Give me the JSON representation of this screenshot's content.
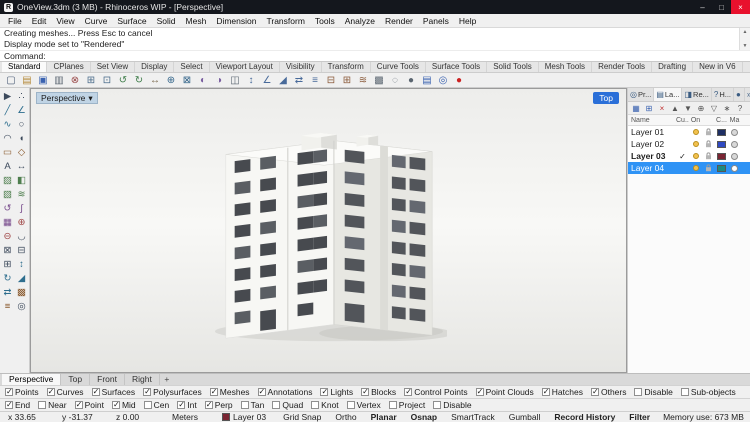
{
  "colors": {
    "selection_blue": "#2f93f5",
    "titlebar": "#14171d",
    "top_button_blue": "#2a6fd8",
    "bulb_yellow": "#f2c14e"
  },
  "window": {
    "title": "OneView.3dm (3 MB) - Rhinoceros WIP - [Perspective]",
    "app_initial": "R",
    "minimize": "–",
    "maximize": "□",
    "close": "×"
  },
  "menu": {
    "items": [
      "File",
      "Edit",
      "View",
      "Curve",
      "Surface",
      "Solid",
      "Mesh",
      "Dimension",
      "Transform",
      "Tools",
      "Analyze",
      "Render",
      "Panels",
      "Help"
    ]
  },
  "command": {
    "history_line1": "Creating meshes... Press Esc to cancel",
    "history_line2": "Display mode set to \"Rendered\"",
    "prompt": "Command:",
    "scroll_up": "▲",
    "scroll_down": "▼"
  },
  "toolbar_tabs": {
    "items": [
      {
        "label": "Standard",
        "active": true
      },
      {
        "label": "CPlanes",
        "active": false
      },
      {
        "label": "Set View",
        "active": false
      },
      {
        "label": "Display",
        "active": false
      },
      {
        "label": "Select",
        "active": false
      },
      {
        "label": "Viewport Layout",
        "active": false
      },
      {
        "label": "Visibility",
        "active": false
      },
      {
        "label": "Transform",
        "active": false
      },
      {
        "label": "Curve Tools",
        "active": false
      },
      {
        "label": "Surface Tools",
        "active": false
      },
      {
        "label": "Solid Tools",
        "active": false
      },
      {
        "label": "Mesh Tools",
        "active": false
      },
      {
        "label": "Render Tools",
        "active": false
      },
      {
        "label": "Drafting",
        "active": false
      },
      {
        "label": "New in V6",
        "active": false
      }
    ]
  },
  "main_toolbar": {
    "icons": [
      {
        "name": "new-file-icon",
        "glyph": "▢",
        "color": "#4a5b75"
      },
      {
        "name": "open-file-icon",
        "glyph": "▤",
        "color": "#b58a3a"
      },
      {
        "name": "save-file-icon",
        "glyph": "▣",
        "color": "#3a62b0"
      },
      {
        "name": "print-icon",
        "glyph": "▥",
        "color": "#5a6570"
      },
      {
        "name": "cut-icon",
        "glyph": "⊗",
        "color": "#9a4a4a"
      },
      {
        "name": "copy-icon",
        "glyph": "⊞",
        "color": "#4a6b8a"
      },
      {
        "name": "paste-icon",
        "glyph": "⊡",
        "color": "#4a6b8a"
      },
      {
        "name": "undo-icon",
        "glyph": "↺",
        "color": "#3f7d4a"
      },
      {
        "name": "redo-icon",
        "glyph": "↻",
        "color": "#3f7d4a"
      },
      {
        "name": "pan-view-icon",
        "glyph": "↔",
        "color": "#77664a"
      },
      {
        "name": "zoom-extents-icon",
        "glyph": "⊕",
        "color": "#33658a"
      },
      {
        "name": "zoom-window-icon",
        "glyph": "⊠",
        "color": "#33658a"
      },
      {
        "name": "rotate-view-icon",
        "glyph": "◐",
        "color": "#7a5fa0"
      },
      {
        "name": "shaded-view-icon",
        "glyph": "◑",
        "color": "#7a5fa0"
      },
      {
        "name": "wireframe-view-icon",
        "glyph": "◫",
        "color": "#5a6570"
      },
      {
        "name": "move-icon",
        "glyph": "↕",
        "color": "#486a9a"
      },
      {
        "name": "rotate-icon",
        "glyph": "∠",
        "color": "#486a9a"
      },
      {
        "name": "scale-icon",
        "glyph": "◢",
        "color": "#486a9a"
      },
      {
        "name": "mirror-icon",
        "glyph": "⇄",
        "color": "#486a9a"
      },
      {
        "name": "offset-icon",
        "glyph": "≡",
        "color": "#486a9a"
      },
      {
        "name": "trim-icon",
        "glyph": "⊟",
        "color": "#8a5a3a"
      },
      {
        "name": "split-icon",
        "glyph": "⊞",
        "color": "#8a5a3a"
      },
      {
        "name": "join-icon",
        "glyph": "≋",
        "color": "#8a5a3a"
      },
      {
        "name": "group-icon",
        "glyph": "▩",
        "color": "#5a6570"
      },
      {
        "name": "hide-object-icon",
        "glyph": "◌",
        "color": "#5a6570"
      },
      {
        "name": "lock-object-icon",
        "glyph": "●",
        "color": "#5a6570"
      },
      {
        "name": "layers-icon",
        "glyph": "▤",
        "color": "#3a62b0"
      },
      {
        "name": "properties-icon",
        "glyph": "◎",
        "color": "#3a62b0"
      },
      {
        "name": "record-history-icon",
        "glyph": "●",
        "color": "#cc2222"
      }
    ]
  },
  "left_toolbar": {
    "icons": [
      {
        "name": "select-icon",
        "glyph": "▶",
        "color": "#3d4a5c"
      },
      {
        "name": "points-icon",
        "glyph": "∴",
        "color": "#3d4a5c"
      },
      {
        "name": "line-icon",
        "glyph": "╱",
        "color": "#2e6e8e"
      },
      {
        "name": "polyline-icon",
        "glyph": "∠",
        "color": "#2e6e8e"
      },
      {
        "name": "curve-icon",
        "glyph": "∿",
        "color": "#2e6e8e"
      },
      {
        "name": "circle-icon",
        "glyph": "○",
        "color": "#3d4a5c"
      },
      {
        "name": "arc-icon",
        "glyph": "◠",
        "color": "#3d4a5c"
      },
      {
        "name": "ellipse-icon",
        "glyph": "◖",
        "color": "#3d4a5c"
      },
      {
        "name": "rectangle-icon",
        "glyph": "▭",
        "color": "#8a5a2e"
      },
      {
        "name": "polygon-icon",
        "glyph": "◇",
        "color": "#8a5a2e"
      },
      {
        "name": "text-icon",
        "glyph": "A",
        "color": "#3d4a5c"
      },
      {
        "name": "dimension-icon",
        "glyph": "↔",
        "color": "#3d4a5c"
      },
      {
        "name": "hatch-icon",
        "glyph": "▨",
        "color": "#4e7e4e"
      },
      {
        "name": "surface-icon",
        "glyph": "◧",
        "color": "#4e7e4e"
      },
      {
        "name": "extrude-icon",
        "glyph": "▧",
        "color": "#4e7e4e"
      },
      {
        "name": "loft-icon",
        "glyph": "≋",
        "color": "#4e7e4e"
      },
      {
        "name": "revolve-icon",
        "glyph": "↺",
        "color": "#7a4e8e"
      },
      {
        "name": "sweep-icon",
        "glyph": "∫",
        "color": "#7a4e8e"
      },
      {
        "name": "mesh-icon",
        "glyph": "▦",
        "color": "#7a4e8e"
      },
      {
        "name": "boolean-union-icon",
        "glyph": "⊕",
        "color": "#a04848"
      },
      {
        "name": "boolean-difference-icon",
        "glyph": "⊖",
        "color": "#a04848"
      },
      {
        "name": "fillet-icon",
        "glyph": "◡",
        "color": "#3d4a5c"
      },
      {
        "name": "trim-curve-icon",
        "glyph": "⊠",
        "color": "#3d4a5c"
      },
      {
        "name": "split-curve-icon",
        "glyph": "⊟",
        "color": "#3d4a5c"
      },
      {
        "name": "join-curve-icon",
        "glyph": "⊞",
        "color": "#3d4a5c"
      },
      {
        "name": "move-object-icon",
        "glyph": "↕",
        "color": "#2e6e8e"
      },
      {
        "name": "rotate-object-icon",
        "glyph": "↻",
        "color": "#2e6e8e"
      },
      {
        "name": "scale-object-icon",
        "glyph": "◢",
        "color": "#2e6e8e"
      },
      {
        "name": "mirror-object-icon",
        "glyph": "⇄",
        "color": "#2e6e8e"
      },
      {
        "name": "array-icon",
        "glyph": "▩",
        "color": "#8a5a2e"
      },
      {
        "name": "offset-curve-icon",
        "glyph": "≡",
        "color": "#8a5a2e"
      },
      {
        "name": "gumball-icon",
        "glyph": "◎",
        "color": "#3d4a5c"
      }
    ]
  },
  "viewport": {
    "label": "Perspective",
    "dropdown_arrow": "▾",
    "top_button": "Top",
    "tabs": {
      "items": [
        {
          "label": "Perspective",
          "active": true
        },
        {
          "label": "Top",
          "active": false
        },
        {
          "label": "Front",
          "active": false
        },
        {
          "label": "Right",
          "active": false
        }
      ],
      "add": "+"
    }
  },
  "right_panel": {
    "tabs": [
      {
        "name": "tab-properties",
        "glyph": "◎",
        "label": "Pr...",
        "active": false
      },
      {
        "name": "tab-layers",
        "glyph": "▤",
        "label": "La...",
        "active": true
      },
      {
        "name": "tab-rendering",
        "glyph": "◨",
        "label": "Re...",
        "active": false
      },
      {
        "name": "tab-help",
        "glyph": "?",
        "label": "H...",
        "active": false
      },
      {
        "name": "tab-materials",
        "glyph": "●",
        "label": "",
        "active": false
      },
      {
        "name": "tab-more",
        "glyph": "»",
        "label": "",
        "active": false
      }
    ],
    "toolbar": [
      {
        "name": "new-layer-icon",
        "glyph": "▦",
        "color": "#3a62b0"
      },
      {
        "name": "new-sublayer-icon",
        "glyph": "⊞",
        "color": "#3a62b0"
      },
      {
        "name": "delete-layer-icon",
        "glyph": "×",
        "color": "#c03030"
      },
      {
        "name": "move-layer-up-icon",
        "glyph": "▲",
        "color": "#555555"
      },
      {
        "name": "move-layer-down-icon",
        "glyph": "▼",
        "color": "#555555"
      },
      {
        "name": "expand-layers-icon",
        "glyph": "⊕",
        "color": "#555555"
      },
      {
        "name": "filter-layers-icon",
        "glyph": "▽",
        "color": "#555555"
      },
      {
        "name": "layer-tools-icon",
        "glyph": "∗",
        "color": "#555555"
      },
      {
        "name": "layer-help-icon",
        "glyph": "?",
        "color": "#555555"
      }
    ],
    "columns": [
      "Name",
      "Cu...",
      "On",
      "",
      "C...",
      "Ma"
    ],
    "layers": [
      {
        "name": "Layer 01",
        "current": false,
        "selected": false,
        "bold": false,
        "swatch": "#1e2f63",
        "material": "#d8d8d8"
      },
      {
        "name": "Layer 02",
        "current": false,
        "selected": false,
        "bold": false,
        "swatch": "#2f49c1",
        "material": "#d8d8d8"
      },
      {
        "name": "Layer 03",
        "current": true,
        "selected": false,
        "bold": true,
        "swatch": "#7a2533",
        "material": "#d8d8d8"
      },
      {
        "name": "Layer 04",
        "current": false,
        "selected": true,
        "bold": false,
        "swatch": "#1d8a7e",
        "material": "#ffffff"
      }
    ]
  },
  "filter_bar": {
    "items": [
      {
        "label": "Points",
        "checked": true
      },
      {
        "label": "Curves",
        "checked": true
      },
      {
        "label": "Surfaces",
        "checked": true
      },
      {
        "label": "Polysurfaces",
        "checked": true
      },
      {
        "label": "Meshes",
        "checked": true
      },
      {
        "label": "Annotations",
        "checked": true
      },
      {
        "label": "Lights",
        "checked": true
      },
      {
        "label": "Blocks",
        "checked": true
      },
      {
        "label": "Control Points",
        "checked": true
      },
      {
        "label": "Point Clouds",
        "checked": true
      },
      {
        "label": "Hatches",
        "checked": true
      },
      {
        "label": "Others",
        "checked": true
      },
      {
        "label": "Disable",
        "checked": false
      },
      {
        "label": "Sub-objects",
        "checked": false
      }
    ]
  },
  "osnap_bar": {
    "items": [
      {
        "label": "End",
        "checked": true
      },
      {
        "label": "Near",
        "checked": false
      },
      {
        "label": "Point",
        "checked": true
      },
      {
        "label": "Mid",
        "checked": true
      },
      {
        "label": "Cen",
        "checked": false
      },
      {
        "label": "Int",
        "checked": true
      },
      {
        "label": "Perp",
        "checked": true
      },
      {
        "label": "Tan",
        "checked": false
      },
      {
        "label": "Quad",
        "checked": false
      },
      {
        "label": "Knot",
        "checked": false
      },
      {
        "label": "Vertex",
        "checked": false
      },
      {
        "label": "Project",
        "checked": false
      },
      {
        "label": "Disable",
        "checked": false
      }
    ]
  },
  "status_bar": {
    "x": "x 33.65",
    "y": "y -31.37",
    "z": "z 0.00",
    "units": "Meters",
    "layer_label": "Layer 03",
    "layer_color": "#7a2533",
    "toggles": [
      {
        "label": "Grid Snap",
        "bold": false
      },
      {
        "label": "Ortho",
        "bold": false
      },
      {
        "label": "Planar",
        "bold": true
      },
      {
        "label": "Osnap",
        "bold": true
      },
      {
        "label": "SmartTrack",
        "bold": false
      },
      {
        "label": "Gumball",
        "bold": false
      },
      {
        "label": "Record History",
        "bold": true
      },
      {
        "label": "Filter",
        "bold": true
      }
    ],
    "memory": "Memory use: 673 MB"
  }
}
